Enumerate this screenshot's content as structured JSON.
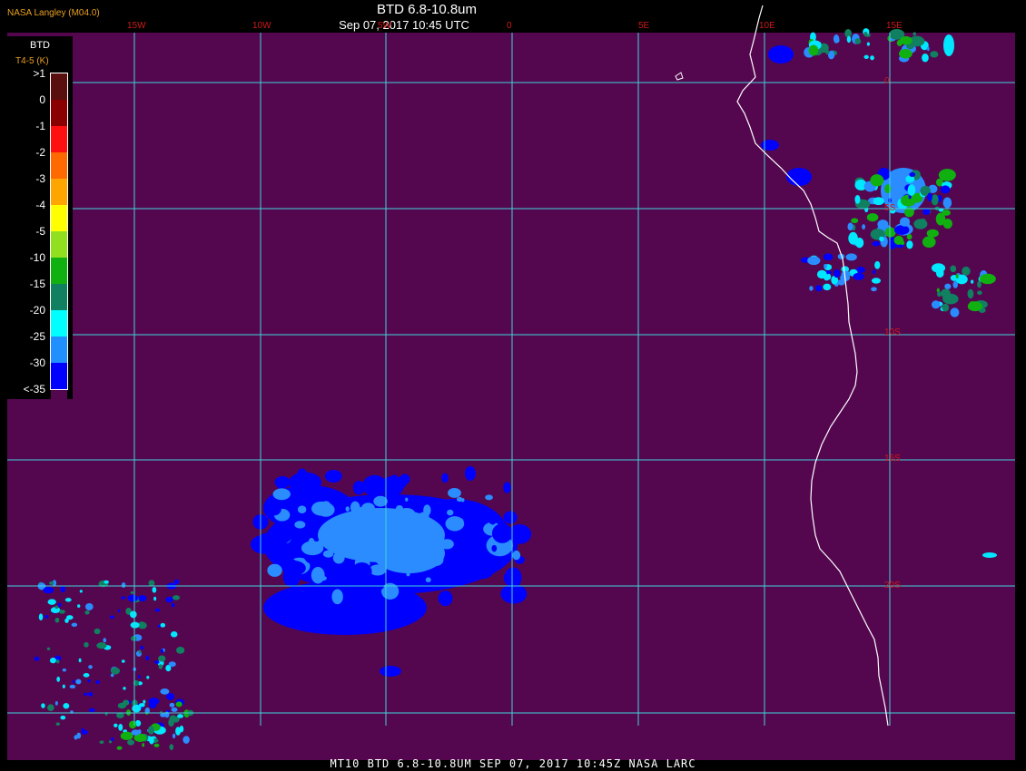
{
  "header": {
    "credit": "NASA Langley (M04.0)",
    "title": "BTD 6.8-10.8um",
    "subtitle": "Sep 07, 2017 10:45 UTC"
  },
  "footer": {
    "text": "MT10  BTD 6.8-10.8UM  SEP 07, 2017 10:45Z  NASA LARC"
  },
  "map": {
    "background_color": "#54074f",
    "grid_color": "#3fd3d8",
    "coastline_color": "#ffffff",
    "label_color": "#d01818",
    "lon_labels": [
      "15W",
      "10W",
      "5W",
      "0",
      "5E",
      "10E",
      "15E"
    ],
    "lat_labels": [
      "0",
      "5S",
      "10S",
      "15S",
      "20S"
    ]
  },
  "legend": {
    "heading": "BTD",
    "units": "T4-5 (K)",
    "entries": [
      {
        "label": ">1",
        "color": "#5a0f0f"
      },
      {
        "label": "0",
        "color": "#8a0000"
      },
      {
        "label": "-1",
        "color": "#ff1010"
      },
      {
        "label": "-2",
        "color": "#ff6a00"
      },
      {
        "label": "-3",
        "color": "#ffa500"
      },
      {
        "label": "-4",
        "color": "#ffff00"
      },
      {
        "label": "-5",
        "color": "#90e020"
      },
      {
        "label": "-10",
        "color": "#10b010"
      },
      {
        "label": "-15",
        "color": "#108060"
      },
      {
        "label": "-20",
        "color": "#00ffff"
      },
      {
        "label": "-25",
        "color": "#2090ff"
      },
      {
        "label": "-30",
        "color": "#0000ff"
      },
      {
        "label": "<-35",
        "color": "#54074f"
      }
    ]
  }
}
